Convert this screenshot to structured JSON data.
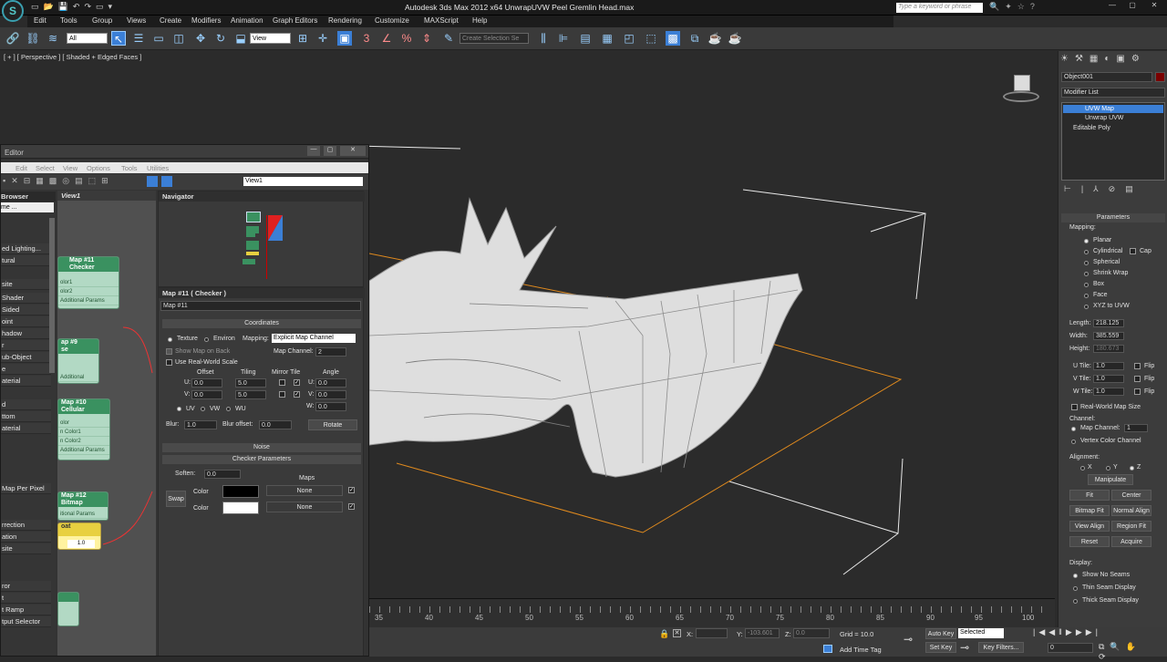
{
  "app": {
    "title": "Autodesk 3ds Max  2012 x64      UnwrapUVW Peel Gremlin Head.max",
    "search_placeholder": "Type a keyword or phrase"
  },
  "menu": [
    "Edit",
    "Tools",
    "Group",
    "Views",
    "Create",
    "Modifiers",
    "Animation",
    "Graph Editors",
    "Rendering",
    "Customize",
    "MAXScript",
    "Help"
  ],
  "toolbar": {
    "selection_filter": "All",
    "ref_coord": "View",
    "named_selection_placeholder": "Create Selection Se"
  },
  "viewport": {
    "label": "[ + ] [ Perspective ] [ Shaded + Edged Faces ]"
  },
  "timeline": {
    "ticks": [
      "35",
      "40",
      "45",
      "50",
      "55",
      "60",
      "65",
      "70",
      "75",
      "80",
      "85",
      "90",
      "95",
      "100"
    ]
  },
  "statusbar": {
    "x_label": "X:",
    "y_label": "Y:",
    "y_value": "-103.601",
    "z_label": "Z:",
    "z_value": "0.0",
    "grid": "Grid = 10.0",
    "add_time_tag": "Add Time Tag",
    "auto_key": "Auto Key",
    "selected": "Selected",
    "set_key": "Set Key",
    "key_filters": "Key Filters...",
    "frame": "0"
  },
  "command_panel": {
    "object_name": "Object001",
    "modifier_list": "Modifier List",
    "stack": [
      "UVW Map",
      "Unwrap UVW",
      "Editable Poly"
    ],
    "parameters": "Parameters",
    "mapping_label": "Mapping:",
    "mapping_options": [
      "Planar",
      "Cylindrical",
      "Spherical",
      "Shrink Wrap",
      "Box",
      "Face",
      "XYZ to UVW"
    ],
    "cap": "Cap",
    "length_label": "Length:",
    "length": "218.125",
    "width_label": "Width:",
    "width": "385.559",
    "height_label": "Height:",
    "height": "180.673",
    "utile_label": "U Tile:",
    "utile": "1.0",
    "vtile_label": "V Tile:",
    "vtile": "1.0",
    "wtile_label": "W Tile:",
    "wtile": "1.0",
    "flip": "Flip",
    "real_world": "Real-World Map Size",
    "channel_label": "Channel:",
    "map_channel_label": "Map Channel:",
    "map_channel": "1",
    "vertex_color_channel": "Vertex Color Channel",
    "alignment_label": "Alignment:",
    "axis_x": "X",
    "axis_y": "Y",
    "axis_z": "Z",
    "manipulate": "Manipulate",
    "fit": "Fit",
    "center": "Center",
    "bitmap_fit": "Bitmap Fit",
    "normal_align": "Normal Align",
    "view_align": "View Align",
    "region_fit": "Region Fit",
    "reset": "Reset",
    "acquire": "Acquire",
    "display_label": "Display:",
    "display_options": [
      "Show No Seams",
      "Thin Seam Display",
      "Thick Seam Display"
    ]
  },
  "slate": {
    "title": "Editor",
    "menu": [
      "Edit",
      "Select",
      "View",
      "Options",
      "Tools",
      "Utilities"
    ],
    "view_dropdown": "View1",
    "browser_header": "Browser",
    "browser_sub": "me ...",
    "view_tab": "View1",
    "navigator": "Navigator",
    "browser_items": [
      "ed Lighting...",
      "tural",
      "site",
      "Shader",
      "Sided",
      "oint",
      "hadow",
      "r",
      "ub-Object",
      "e",
      "aterial",
      "d",
      "ttom",
      "aterial",
      "Map Per Pixel",
      "rrection",
      "ation",
      "site",
      "ror",
      "t",
      "t Ramp",
      "tput Selector"
    ],
    "nodes": {
      "checker_head": "Map #11\nChecker",
      "checker_sockets": [
        "olor1",
        "olor2",
        "Additional Params"
      ],
      "n9_head": "ap #9\nse",
      "n9_sockets": [
        "Additional Params"
      ],
      "cellular_head": "Map #10\nCellular",
      "cellular_sockets": [
        "olor",
        "n Color1",
        "n Color2",
        "Additional Params"
      ],
      "bitmap_head": "Map #12\nBitmap",
      "bitmap_sockets": [
        "itional Params"
      ],
      "yellow_head": "oat",
      "yellow_value": "1.0"
    },
    "props": {
      "title": "Map #11  ( Checker )",
      "name": "Map #11",
      "coordinates": "Coordinates",
      "texture": "Texture",
      "environ": "Environ",
      "mapping_label": "Mapping:",
      "mapping_value": "Explicit Map Channel",
      "show_map_on_back": "Show Map on Back",
      "map_channel_label": "Map Channel:",
      "map_channel": "2",
      "use_real_world": "Use Real-World Scale",
      "offset": "Offset",
      "tiling": "Tiling",
      "mirror_tile": "Mirror Tile",
      "angle": "Angle",
      "u_label": "U:",
      "v_label": "V:",
      "w_label": "W:",
      "u_offset": "0.0",
      "v_offset": "0.0",
      "u_tiling": "5.0",
      "v_tiling": "5.0",
      "u_angle": "0.0",
      "v_angle": "0.0",
      "w_angle": "0.0",
      "uv": "UV",
      "vw": "VW",
      "wu": "WU",
      "blur_label": "Blur:",
      "blur": "1.0",
      "blur_offset_label": "Blur offset:",
      "blur_offset": "0.0",
      "rotate": "Rotate",
      "noise": "Noise",
      "checker_params": "Checker Parameters",
      "soften_label": "Soften:",
      "soften": "0.0",
      "maps": "Maps",
      "swap": "Swap",
      "color1_label": "Color",
      "color2_label": "Color",
      "none1": "None",
      "none2": "None"
    }
  },
  "colors": {
    "accent": "#3a9160",
    "selection": "#3b7fd6",
    "bbox": "#e08a1e"
  }
}
